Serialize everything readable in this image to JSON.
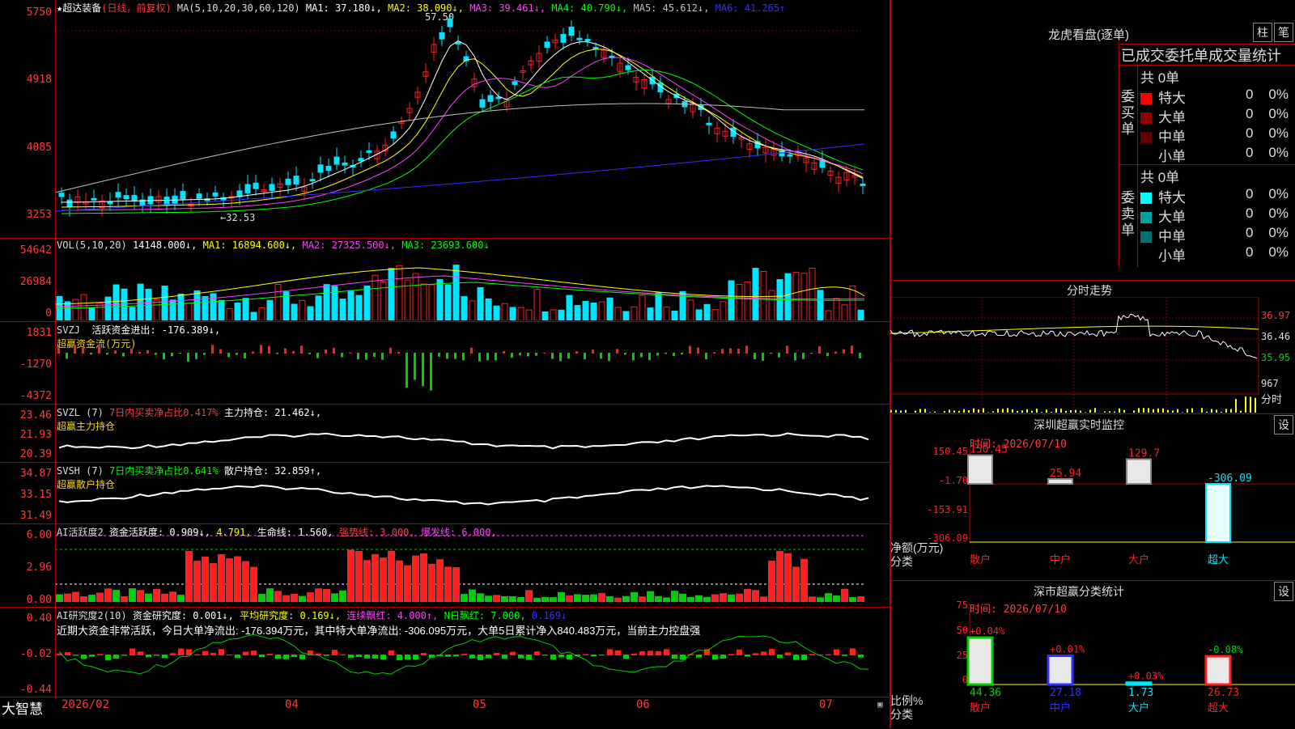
{
  "colors": {
    "up": "#ff2020",
    "down": "#00e5ff",
    "bg": "#000000",
    "grid": "#b00000",
    "ma1": "#ffffff",
    "ma2": "#ffff00",
    "ma3": "#ff40ff",
    "ma4": "#00ff00",
    "ma5": "#c0c0c0",
    "ma6": "#3030ff",
    "green": "#00d000",
    "gold": "#ffd700"
  },
  "kline": {
    "title": "★超达装备",
    "period": "(日线，前复权)",
    "ma_params": "MA(5,10,20,30,60,120)",
    "ma1": "MA1: 37.180↓,",
    "ma2": "MA2: 38.090↓,",
    "ma3": "MA3: 39.461↓,",
    "ma4": "MA4: 40.790↓,",
    "ma5": "MA5: 45.612↓,",
    "ma6": "MA6: 41.265↑",
    "yticks": [
      "5750",
      "4918",
      "4085",
      "3253"
    ],
    "high_label": "57.50",
    "low_label": "←32.53"
  },
  "vol": {
    "title": "VOL(5,10,20)",
    "val": "14148.000↓,",
    "ma1": "MA1: 16894.600↓,",
    "ma2": "MA2: 27325.500↓,",
    "ma3": "MA3: 23693.600↓",
    "yticks": [
      "54642",
      "26984",
      "0"
    ]
  },
  "svzj": {
    "title": "SVZJ",
    "label": "活跃资金进出: -176.389↓,",
    "sub": "超赢资金流(万元)",
    "yticks": [
      "1831",
      "-1270",
      "-4372"
    ]
  },
  "svzl": {
    "title": "SVZL (7)",
    "label1": "7日内买卖净占比0.417%",
    "label2": "主力持仓: 21.462↓,",
    "sub": "超赢主力持仓",
    "yticks": [
      "23.46",
      "21.93",
      "20.39"
    ]
  },
  "svsh": {
    "title": "SVSH (7)",
    "label1": "7日内买卖净占比0.641%",
    "label2": "散户持仓: 32.859↑,",
    "sub": "超赢散户持仓",
    "yticks": [
      "34.87",
      "33.15",
      "31.49"
    ]
  },
  "ai1": {
    "title": "AI活跃度2",
    "label1": "资金活跃度: 0.909↓,",
    "label2": "4.791,",
    "label3": "生命线: 1.560,",
    "label4": "强势线: 3.000,",
    "label5": "爆发线: 6.000,",
    "yticks": [
      "6.00",
      "2.96",
      "0.00"
    ]
  },
  "ai2": {
    "title": "AI研究度2(10)",
    "label1": "资金研究度: 0.001↓,",
    "label2": "平均研究度: 0.169↓,",
    "label3": "连续飘红: 4.000↑,",
    "label4": "N日飘红: 7.000,",
    "label5": "0.169↓",
    "comment": "近期大资金非常活跃，今日大单净流出: -176.394万元，其中特大单净流出: -306.095万元，大单5日累计净入840.483万元，当前主力控盘强",
    "yticks": [
      "0.40",
      "-0.02",
      "-0.44"
    ]
  },
  "footer": {
    "brand": "大智慧",
    "dates": [
      "2026/02",
      "04",
      "05",
      "06",
      "07"
    ]
  },
  "lhb": {
    "title": "龙虎看盘(逐单)",
    "btn1": "柱",
    "btn2": "笔",
    "header": "已成交委托单成交量统计",
    "buy_label": "委买单",
    "buy_total": "共 0单",
    "sell_label": "委卖单",
    "sell_total": "共 0单",
    "rows": [
      {
        "name": "特大",
        "v": "0",
        "p": "0%"
      },
      {
        "name": "大单",
        "v": "0",
        "p": "0%"
      },
      {
        "name": "中单",
        "v": "0",
        "p": "0%"
      },
      {
        "name": "小单",
        "v": "0",
        "p": "0%"
      }
    ],
    "buy_colors": [
      "#ff0000",
      "#900000",
      "#600000"
    ],
    "sell_colors": [
      "#00ffff",
      "#00a0a0",
      "#007070"
    ]
  },
  "intraday": {
    "title": "分时走势",
    "yticks": [
      "36.97",
      "36.46",
      "35.95"
    ],
    "vol_label": "967",
    "unit": "分时"
  },
  "monitor": {
    "title": "深圳超赢实时监控",
    "btn": "设",
    "time": "时间: 2026/07/10",
    "yticks": [
      "150.45",
      "-1.70",
      "-153.91",
      "-306.09"
    ],
    "bars": [
      {
        "v": 150.45,
        "label": "150.45"
      },
      {
        "v": 25.94,
        "label": "25.94"
      },
      {
        "v": 129.7,
        "label": "129.7"
      },
      {
        "v": -306.09,
        "label": "-306.09"
      }
    ],
    "cats": [
      "散户",
      "中户",
      "大户",
      "超大"
    ],
    "axis1": "净额(万元)",
    "axis2": "分类"
  },
  "classify": {
    "title": "深市超赢分类统计",
    "btn": "设",
    "time": "时间: 2026/07/10",
    "yticks": [
      "75",
      "50",
      "25",
      "0"
    ],
    "bars": [
      {
        "v": 44.36,
        "top": "+0.04%",
        "bot": "44.36"
      },
      {
        "v": 27.18,
        "top": "+0.01%",
        "bot": "27.18"
      },
      {
        "v": 1.73,
        "top": "+0.03%",
        "bot": "1.73"
      },
      {
        "v": 26.73,
        "top": "-0.08%",
        "bot": "26.73"
      }
    ],
    "cats": [
      "散户",
      "中户",
      "大户",
      "超大"
    ],
    "axis1": "比例%",
    "axis2": "分类"
  }
}
